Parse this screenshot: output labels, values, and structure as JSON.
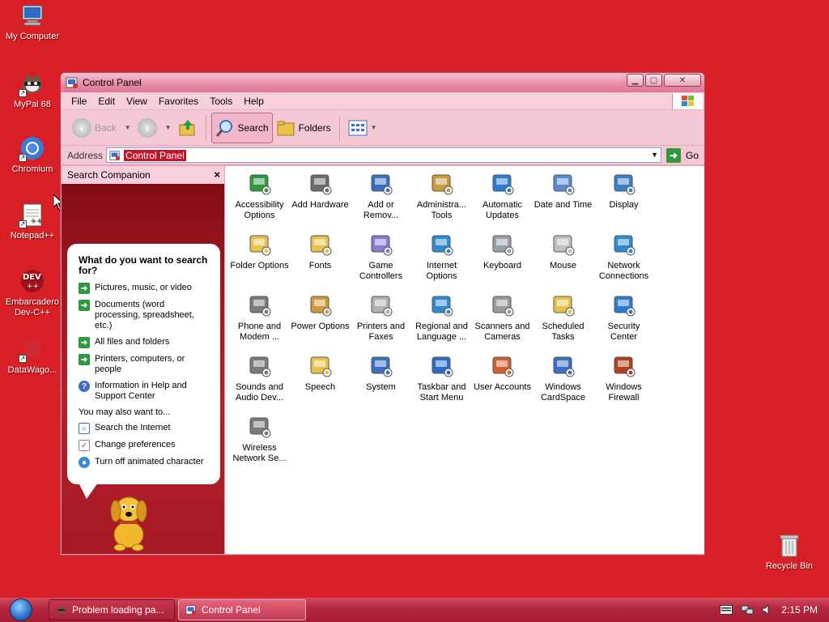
{
  "desktop": {
    "icons": [
      {
        "label": "My Computer",
        "icon": "computer-icon"
      },
      {
        "label": "MyPal 68",
        "icon": "mypal-icon"
      },
      {
        "label": "Chromium",
        "icon": "chromium-icon"
      },
      {
        "label": "Notepad++",
        "icon": "notepadpp-icon"
      },
      {
        "label": "Embarcadero Dev-C++",
        "icon": "devcpp-icon"
      },
      {
        "label": "DataWago...",
        "icon": "datawago-icon"
      },
      {
        "label": "Recycle Bin",
        "icon": "recycle-bin-icon"
      }
    ]
  },
  "window": {
    "title": "Control Panel",
    "menu": [
      "File",
      "Edit",
      "View",
      "Favorites",
      "Tools",
      "Help"
    ],
    "toolbar": {
      "back": "Back",
      "search": "Search",
      "folders": "Folders"
    },
    "address": {
      "label": "Address",
      "value": "Control Panel",
      "go": "Go"
    }
  },
  "search_companion": {
    "title": "Search Companion",
    "question": "What do you want to search for?",
    "options": [
      "Pictures, music, or video",
      "Documents (word processing, spreadsheet, etc.)",
      "All files and folders",
      "Printers, computers, or people",
      "Information in Help and Support Center"
    ],
    "also_label": "You may also want to...",
    "also": [
      "Search the Internet",
      "Change preferences",
      "Turn off animated character"
    ]
  },
  "control_panel": {
    "items": [
      {
        "label": "Accessibility Options",
        "icon": "accessibility-icon",
        "color": "#2e9a3e"
      },
      {
        "label": "Add Hardware",
        "icon": "add-hardware-icon",
        "color": "#6a6a6a"
      },
      {
        "label": "Add or Remov...",
        "icon": "add-remove-programs-icon",
        "color": "#3a6fc4"
      },
      {
        "label": "Administra... Tools",
        "icon": "administrative-tools-icon",
        "color": "#c89a3a"
      },
      {
        "label": "Automatic Updates",
        "icon": "automatic-updates-icon",
        "color": "#2e7ad1"
      },
      {
        "label": "Date and Time",
        "icon": "date-time-icon",
        "color": "#5a8bd0"
      },
      {
        "label": "Display",
        "icon": "display-icon",
        "color": "#3a7fc4"
      },
      {
        "label": "Folder Options",
        "icon": "folder-options-icon",
        "color": "#e8c24a"
      },
      {
        "label": "Fonts",
        "icon": "fonts-icon",
        "color": "#e8c24a"
      },
      {
        "label": "Game Controllers",
        "icon": "game-controllers-icon",
        "color": "#8a7ad0"
      },
      {
        "label": "Internet Options",
        "icon": "internet-options-icon",
        "color": "#2e8ad1"
      },
      {
        "label": "Keyboard",
        "icon": "keyboard-icon",
        "color": "#9aa0a8"
      },
      {
        "label": "Mouse",
        "icon": "mouse-icon",
        "color": "#c0c0c0"
      },
      {
        "label": "Network Connections",
        "icon": "network-connections-icon",
        "color": "#2e8ad1"
      },
      {
        "label": "Phone and Modem ...",
        "icon": "phone-modem-icon",
        "color": "#7a7a7a"
      },
      {
        "label": "Power Options",
        "icon": "power-options-icon",
        "color": "#d09a3a"
      },
      {
        "label": "Printers and Faxes",
        "icon": "printers-faxes-icon",
        "color": "#b0b0b0"
      },
      {
        "label": "Regional and Language ...",
        "icon": "regional-language-icon",
        "color": "#2e8ad1"
      },
      {
        "label": "Scanners and Cameras",
        "icon": "scanners-cameras-icon",
        "color": "#9a9a9a"
      },
      {
        "label": "Scheduled Tasks",
        "icon": "scheduled-tasks-icon",
        "color": "#e8c24a"
      },
      {
        "label": "Security Center",
        "icon": "security-center-icon",
        "color": "#2e7ad1"
      },
      {
        "label": "Sounds and Audio Dev...",
        "icon": "sounds-audio-icon",
        "color": "#7a7a7a"
      },
      {
        "label": "Speech",
        "icon": "speech-icon",
        "color": "#e8c24a"
      },
      {
        "label": "System",
        "icon": "system-icon",
        "color": "#3a6fc4"
      },
      {
        "label": "Taskbar and Start Menu",
        "icon": "taskbar-start-menu-icon",
        "color": "#2e6ac4"
      },
      {
        "label": "User Accounts",
        "icon": "user-accounts-icon",
        "color": "#d0602e"
      },
      {
        "label": "Windows CardSpace",
        "icon": "cardspace-icon",
        "color": "#3a6fc4"
      },
      {
        "label": "Windows Firewall",
        "icon": "firewall-icon",
        "color": "#b04020"
      },
      {
        "label": "Wireless Network Se...",
        "icon": "wireless-network-icon",
        "color": "#7a7a7a"
      }
    ]
  },
  "taskbar": {
    "buttons": [
      {
        "label": "Problem loading pa...",
        "icon": "mypal-icon",
        "active": false
      },
      {
        "label": "Control Panel",
        "icon": "control-panel-icon",
        "active": true
      }
    ],
    "clock": "2:15 PM"
  },
  "colors": {
    "desktop": "#d91f26",
    "window_chrome": "#f5c8d6",
    "selection": "#c3162d",
    "accent_green": "#2e9a3e"
  }
}
